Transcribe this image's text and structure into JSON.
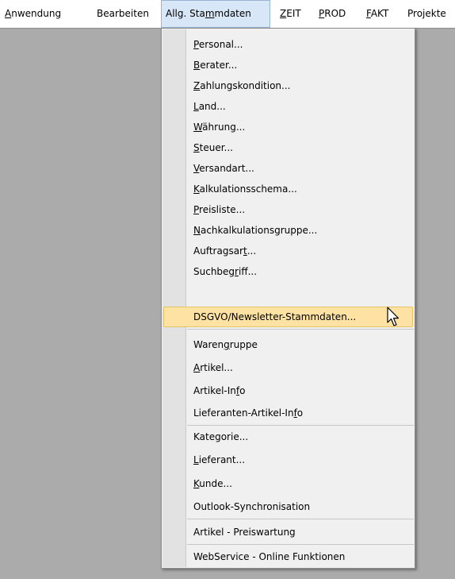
{
  "menubar": {
    "items": [
      {
        "u": "A",
        "rest": "nwendung"
      },
      {
        "pre": "Bearbeiten"
      },
      {
        "pre": "Allg. Sta",
        "u": "m",
        "rest": "mdaten"
      },
      {
        "u": "Z",
        "rest": "EIT"
      },
      {
        "u": "P",
        "rest": "ROD"
      },
      {
        "u": "F",
        "rest": "AKT"
      },
      {
        "pre": "Projekte"
      }
    ]
  },
  "dropdown": {
    "items": [
      {
        "u": "P",
        "rest": "ersonal..."
      },
      {
        "u": "B",
        "rest": "erater..."
      },
      {
        "u": "Z",
        "rest": "ahlungskondition..."
      },
      {
        "u": "L",
        "rest": "and..."
      },
      {
        "u": "W",
        "rest": "ährung..."
      },
      {
        "u": "S",
        "rest": "teuer..."
      },
      {
        "u": "V",
        "rest": "ersandart..."
      },
      {
        "u": "K",
        "rest": "alkulationsschema..."
      },
      {
        "u": "P",
        "rest": "reisliste..."
      },
      {
        "u": "N",
        "rest": "achkalkulationsgruppe..."
      },
      {
        "pre": "Auftragsar",
        "u": "t",
        "rest": "..."
      },
      {
        "pre": "Suchbeg",
        "u": "r",
        "rest": "iff..."
      },
      {
        "pre": "DSGVO/Newsletter-Stammdaten..."
      },
      {
        "pre": "Waren",
        "u": "g",
        "rest": "ruppe"
      },
      {
        "u": "A",
        "rest": "rtikel..."
      },
      {
        "pre": "Artikel-In",
        "u": "f",
        "rest": "o"
      },
      {
        "pre": "Lieferanten-Artikel-In",
        "u": "f",
        "rest": "o"
      },
      {
        "pre": "Kategorie..."
      },
      {
        "u": "L",
        "rest": "ieferant..."
      },
      {
        "u": "K",
        "rest": "unde..."
      },
      {
        "pre": "Outlook-Synchronisation"
      },
      {
        "pre": "Artikel - Preiswartung"
      },
      {
        "pre": "WebService - Online Funktionen"
      }
    ]
  }
}
